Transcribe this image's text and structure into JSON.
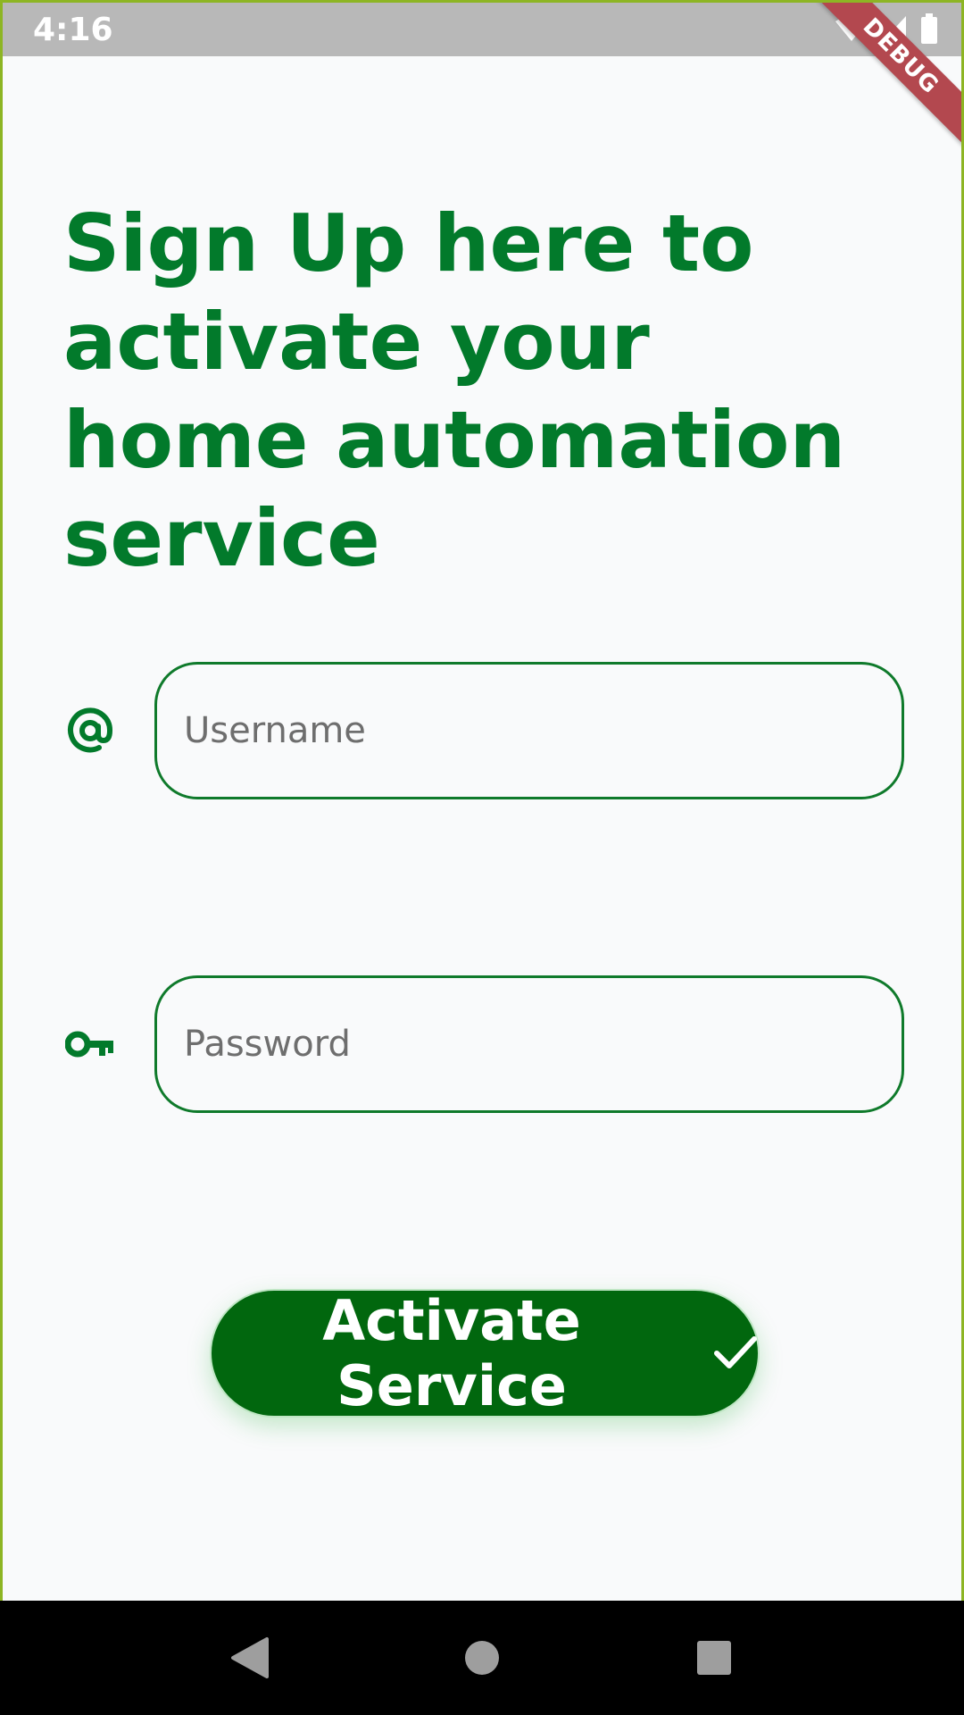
{
  "status_bar": {
    "time": "4:16",
    "icons": [
      "wifi-icon",
      "signal-icon",
      "battery-icon"
    ]
  },
  "debug_banner": {
    "label": "DEBUG"
  },
  "headline": "Sign Up here to activate your home automation service",
  "form": {
    "username": {
      "placeholder": "Username",
      "value": "",
      "icon": "at-sign-icon"
    },
    "password": {
      "placeholder": "Password",
      "value": "",
      "icon": "key-icon"
    }
  },
  "activate_button": {
    "label": "Activate Service",
    "icon": "check-icon"
  },
  "nav_bar": {
    "buttons": [
      "back-icon",
      "home-icon",
      "recents-icon"
    ]
  },
  "colors": {
    "accent": "#027a2b",
    "button_bg": "#01670e",
    "background": "#f9fafb",
    "status_bar": "#b8b8b8"
  }
}
